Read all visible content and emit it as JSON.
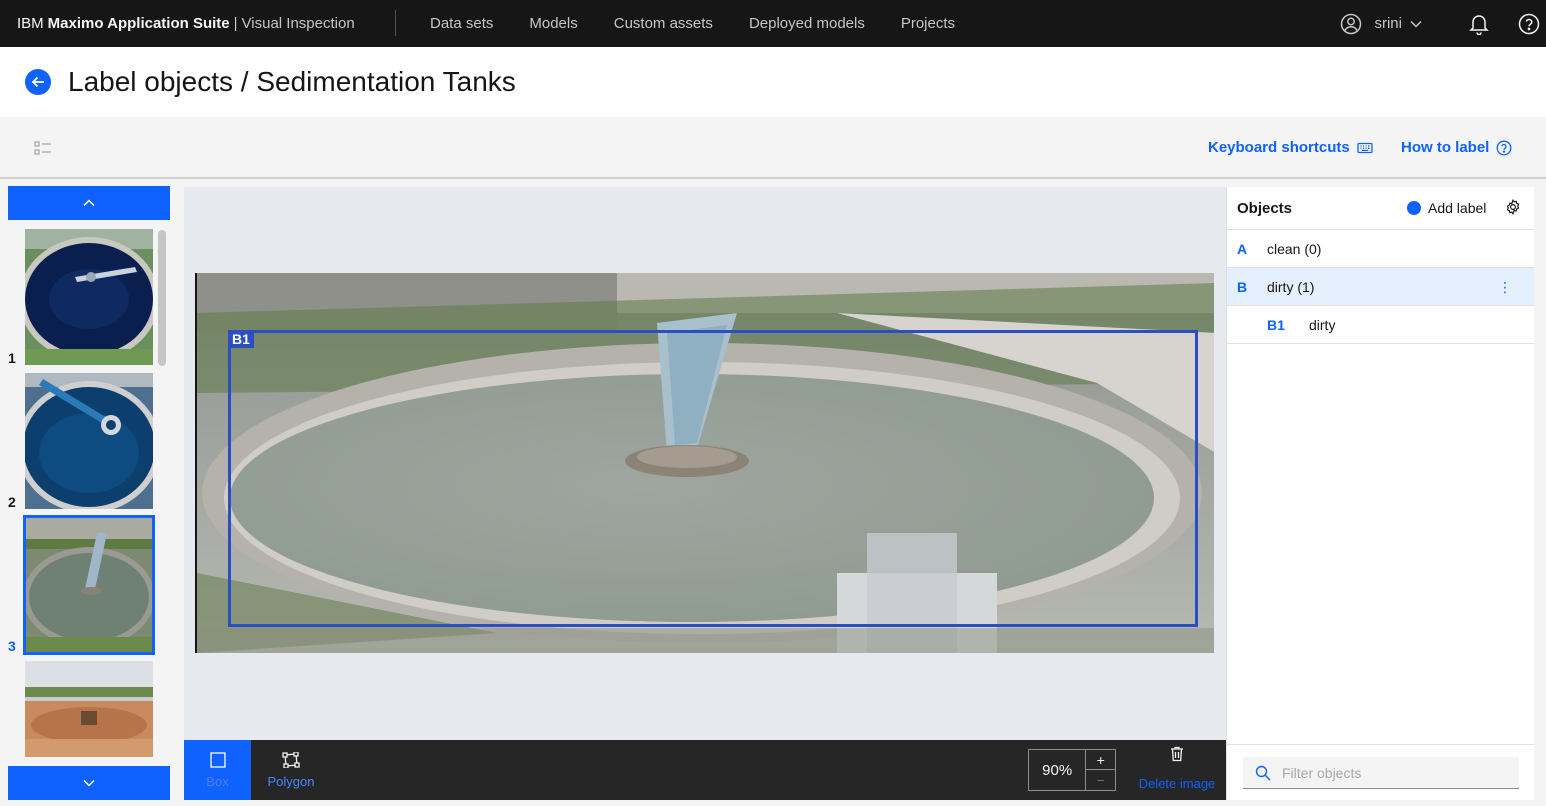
{
  "topnav": {
    "brand_prefix": "IBM",
    "brand_name": "Maximo Application Suite",
    "brand_separator": "|",
    "product": "Visual Inspection",
    "items": [
      {
        "label": "Data sets"
      },
      {
        "label": "Models"
      },
      {
        "label": "Custom assets"
      },
      {
        "label": "Deployed models"
      },
      {
        "label": "Projects"
      }
    ],
    "user": "srini"
  },
  "title": {
    "text": "Label objects / Sedimentation Tanks"
  },
  "toolbar": {
    "keyboard_shortcuts": "Keyboard shortcuts",
    "how_to_label": "How to label"
  },
  "thumbnails": [
    {
      "number": "1"
    },
    {
      "number": "2"
    },
    {
      "number": "3",
      "selected": true
    },
    {
      "number": ""
    }
  ],
  "canvas": {
    "box_tag": "B1"
  },
  "bottom_bar": {
    "box_label": "Box",
    "polygon_label": "Polygon",
    "zoom_value": "90%",
    "zoom_in": "+",
    "zoom_out": "−",
    "delete_image": "Delete image"
  },
  "objects": {
    "title": "Objects",
    "add_label": "Add label",
    "rows": [
      {
        "key": "A",
        "name": "clean (0)"
      },
      {
        "key": "B",
        "name": "dirty (1)",
        "selected": true
      },
      {
        "key": "B1",
        "name": "dirty"
      }
    ],
    "filter_placeholder": "Filter objects"
  },
  "colors": {
    "accent": "#0f62fe",
    "nav_bg": "#161616",
    "box_outline": "#2b4fc2",
    "selected_row": "#e5f0ff"
  }
}
